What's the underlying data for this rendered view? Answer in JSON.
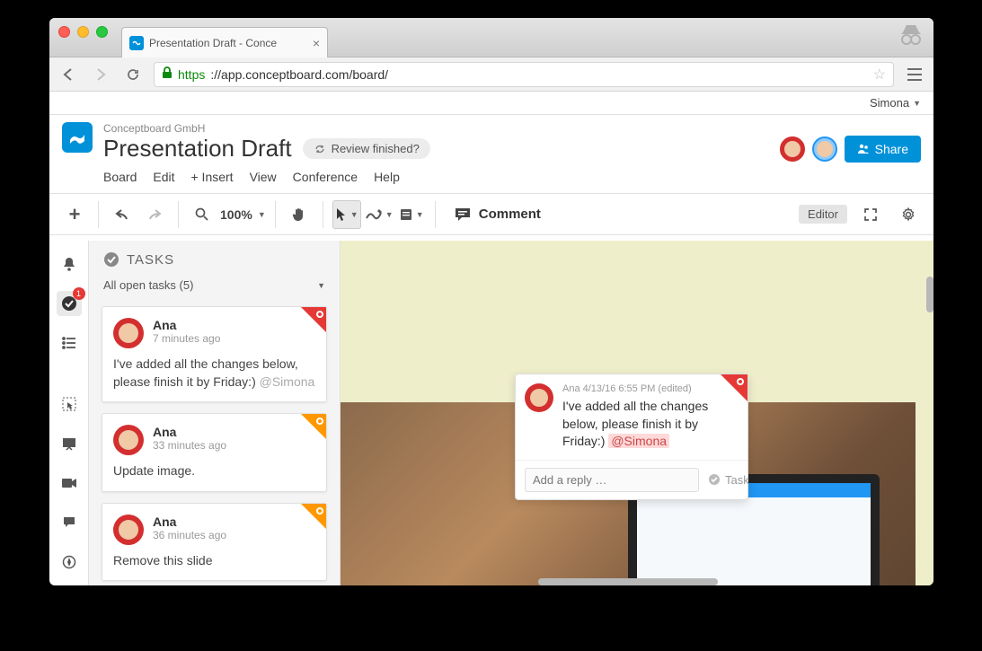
{
  "browser": {
    "tab_title": "Presentation Draft - Conce",
    "url_https": "https",
    "url_rest": "://app.conceptboard.com/board/"
  },
  "userbar": {
    "name": "Simona"
  },
  "header": {
    "company": "Conceptboard GmbH",
    "title": "Presentation Draft",
    "review_label": "Review finished?",
    "share_label": "Share"
  },
  "menu": {
    "board": "Board",
    "edit": "Edit",
    "insert": "+ Insert",
    "view": "View",
    "conference": "Conference",
    "help": "Help"
  },
  "toolbar": {
    "zoom": "100%",
    "comment": "Comment",
    "editor": "Editor"
  },
  "sidebar": {
    "badge": "1"
  },
  "tasks": {
    "title": "TASKS",
    "filter": "All open tasks (5)",
    "cards": [
      {
        "name": "Ana",
        "time": "7 minutes ago",
        "text": "I've added all the changes below, please finish it by Friday:)",
        "mention": "@Simona",
        "corner": "red"
      },
      {
        "name": "Ana",
        "time": "33 minutes ago",
        "text": "Update image.",
        "corner": "orange"
      },
      {
        "name": "Ana",
        "time": "36 minutes ago",
        "text": "Remove this slide",
        "corner": "orange"
      }
    ]
  },
  "popup": {
    "meta": "Ana 4/13/16 6:55 PM (edited)",
    "text": "I've added all the changes below, please finish it by Friday:)",
    "mention": "@Simona",
    "reply_placeholder": "Add a reply …",
    "task_label": "Task"
  }
}
